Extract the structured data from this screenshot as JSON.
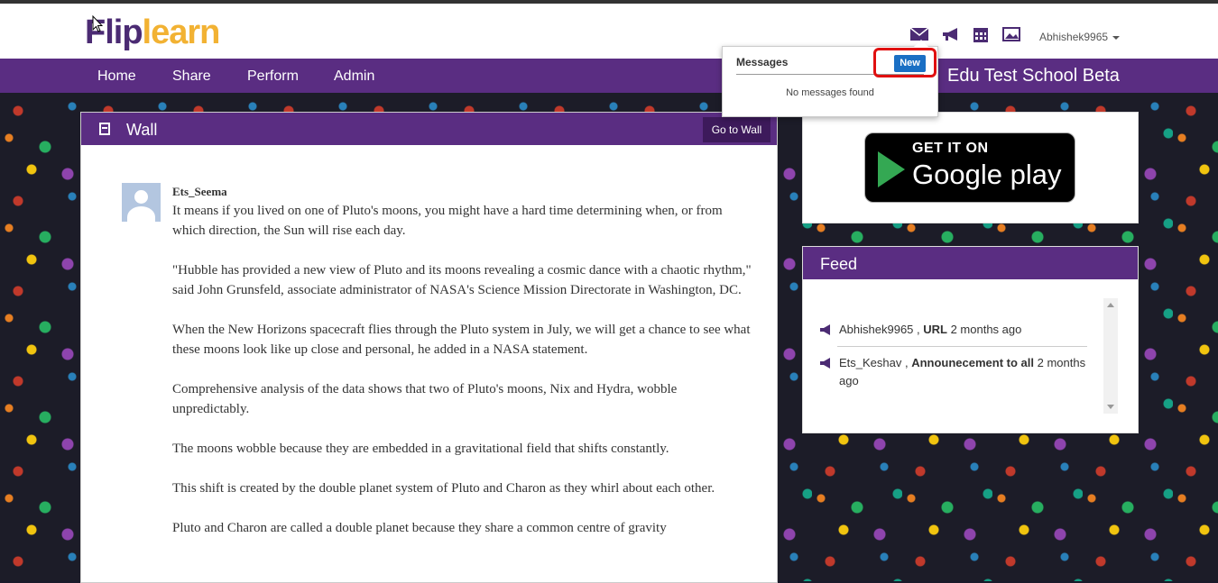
{
  "logo": {
    "part1": "Flip",
    "part2": "learn"
  },
  "header": {
    "user": "Abhishek9965",
    "icons": [
      "envelope-icon",
      "megaphone-icon",
      "calendar-icon",
      "image-icon"
    ]
  },
  "nav": {
    "items": [
      "Home",
      "Share",
      "Perform",
      "Admin"
    ],
    "school": "Edu Test School Beta"
  },
  "messages": {
    "title": "Messages",
    "new_label": "New",
    "empty_text": "No messages found"
  },
  "wall": {
    "title": "Wall",
    "goto_label": "Go to Wall",
    "post": {
      "author": "Ets_Seema",
      "paragraphs": [
        "It means if you lived on one of Pluto's moons, you might have a hard time determining when, or from which direction, the Sun will rise each day.",
        "\"Hubble has provided a new view of Pluto and its moons revealing a cosmic dance with a chaotic rhythm,\" said John Grunsfeld, associate administrator of NASA's Science Mission Directorate in Washington, DC.",
        "When the New Horizons spacecraft flies through the Pluto system in July, we will get a chance to see what these moons look like up close and personal, he added in a NASA statement.",
        "Comprehensive analysis of the data shows that two of Pluto's moons, Nix and Hydra, wobble unpredictably.",
        "The moons wobble because they are embedded in a gravitational field that shifts constantly.",
        "This shift is created by the double planet system of Pluto and Charon as they whirl about each other.",
        "Pluto and Charon are called a double planet because they share a common centre of gravity"
      ]
    }
  },
  "google_play": {
    "small": "GET IT ON",
    "big": "Google play"
  },
  "feed": {
    "title": "Feed",
    "items": [
      {
        "user": "Abhishek9965",
        "sep": " , ",
        "type": "URL",
        "time": " 2 months ago"
      },
      {
        "user": "Ets_Keshav",
        "sep": " , ",
        "type": "Announecement to all",
        "time": " 2 months ago"
      }
    ]
  },
  "colors": {
    "brand_purple": "#5a2d82",
    "logo_yellow": "#f2b233",
    "new_blue": "#1a6fc4",
    "highlight_red": "#e01010"
  }
}
